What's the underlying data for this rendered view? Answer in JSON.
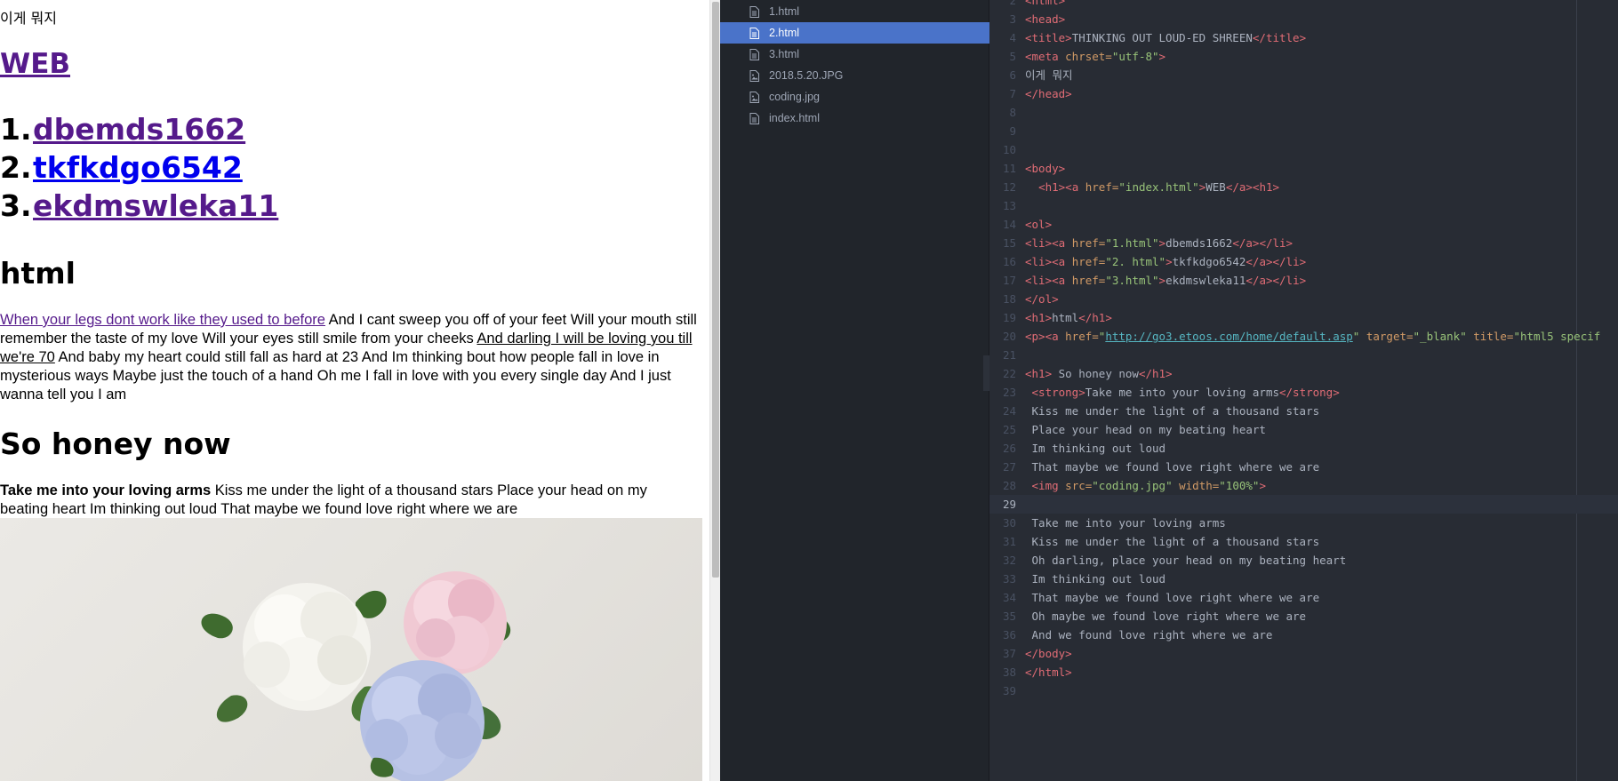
{
  "preview": {
    "meta_text": "이게 뭐지",
    "web_link": "WEB",
    "list": [
      {
        "num": "1.",
        "label": "dbemds1662"
      },
      {
        "num": "2.",
        "label": "tkfkdgo6542"
      },
      {
        "num": "3.",
        "label": "ekdmswleka11"
      }
    ],
    "html_heading": "html",
    "paragraph_link1": "When your legs dont work like they used to before",
    "paragraph_text1": " And I cant sweep you off of your feet Will your mouth still remember the taste of my love Will your eyes still smile from your cheeks ",
    "paragraph_link2": "And darling I will be loving you till we're 70",
    "paragraph_text2": " And baby my heart could still fall as hard at 23 And Im thinking bout how people fall in love in mysterious ways Maybe just the touch of a hand Oh me I fall in love with you every single day And I just wanna tell you I am",
    "honey_heading": "So honey now",
    "honey_strong": "Take me into your loving arms",
    "honey_text": " Kiss me under the light of a thousand stars Place your head on my beating heart Im thinking out loud That maybe we found love right where we are",
    "image_alt": "coding.jpg"
  },
  "tree": {
    "files": [
      {
        "name": "1.html",
        "icon": "file-icon"
      },
      {
        "name": "2.html",
        "icon": "file-icon",
        "active": true
      },
      {
        "name": "3.html",
        "icon": "file-icon"
      },
      {
        "name": "2018.5.20.JPG",
        "icon": "image-file-icon"
      },
      {
        "name": "coding.jpg",
        "icon": "image-file-icon"
      },
      {
        "name": "index.html",
        "icon": "file-icon"
      }
    ],
    "collapse_glyph": "‹"
  },
  "code": {
    "current_line": 29,
    "lines": [
      {
        "n": "2",
        "t": [
          [
            "tag",
            "<html>"
          ]
        ]
      },
      {
        "n": "3",
        "t": [
          [
            "tag",
            "<head>"
          ]
        ]
      },
      {
        "n": "4",
        "t": [
          [
            "tag",
            "<title>"
          ],
          [
            "txt",
            "THINKING OUT LOUD-ED SHREEN"
          ],
          [
            "tag",
            "</title>"
          ]
        ]
      },
      {
        "n": "5",
        "t": [
          [
            "tag",
            "<meta "
          ],
          [
            "attr",
            "chrset="
          ],
          [
            "str",
            "\"utf-8\""
          ],
          [
            "tag",
            ">"
          ]
        ]
      },
      {
        "n": "6",
        "t": [
          [
            "txt",
            "이게 뭐지"
          ]
        ]
      },
      {
        "n": "7",
        "t": [
          [
            "tag",
            "</head>"
          ]
        ]
      },
      {
        "n": "8",
        "t": []
      },
      {
        "n": "9",
        "t": []
      },
      {
        "n": "10",
        "t": []
      },
      {
        "n": "11",
        "t": [
          [
            "tag",
            "<body>"
          ]
        ]
      },
      {
        "n": "12",
        "t": [
          [
            "txt",
            "  "
          ],
          [
            "tag",
            "<h1><a "
          ],
          [
            "attr",
            "href="
          ],
          [
            "str",
            "\"index.html\""
          ],
          [
            "tag",
            ">"
          ],
          [
            "txt",
            "WEB"
          ],
          [
            "tag",
            "</a><h1>"
          ]
        ]
      },
      {
        "n": "13",
        "t": []
      },
      {
        "n": "14",
        "t": [
          [
            "tag",
            "<ol>"
          ]
        ]
      },
      {
        "n": "15",
        "t": [
          [
            "tag",
            "<li><a "
          ],
          [
            "attr",
            "href="
          ],
          [
            "str",
            "\"1.html\""
          ],
          [
            "tag",
            ">"
          ],
          [
            "txt",
            "dbemds1662"
          ],
          [
            "tag",
            "</a></li>"
          ]
        ]
      },
      {
        "n": "16",
        "t": [
          [
            "tag",
            "<li><a "
          ],
          [
            "attr",
            "href="
          ],
          [
            "str",
            "\"2. html\""
          ],
          [
            "tag",
            ">"
          ],
          [
            "txt",
            "tkfkdgo6542"
          ],
          [
            "tag",
            "</a></li>"
          ]
        ]
      },
      {
        "n": "17",
        "t": [
          [
            "tag",
            "<li><a "
          ],
          [
            "attr",
            "href="
          ],
          [
            "str",
            "\"3.html\""
          ],
          [
            "tag",
            ">"
          ],
          [
            "txt",
            "ekdmswleka11"
          ],
          [
            "tag",
            "</a></li>"
          ]
        ]
      },
      {
        "n": "18",
        "t": [
          [
            "tag",
            "</ol>"
          ]
        ]
      },
      {
        "n": "19",
        "t": [
          [
            "tag",
            "<h1>"
          ],
          [
            "txt",
            "html"
          ],
          [
            "tag",
            "</h1>"
          ]
        ]
      },
      {
        "n": "20",
        "t": [
          [
            "tag",
            "<p><a "
          ],
          [
            "attr",
            "href="
          ],
          [
            "str",
            "\""
          ],
          [
            "url",
            "http://go3.etoos.com/home/default.asp"
          ],
          [
            "str",
            "\""
          ],
          [
            "attr",
            " target="
          ],
          [
            "str",
            "\"_blank\""
          ],
          [
            "attr",
            " title="
          ],
          [
            "str",
            "\"html5 specif"
          ]
        ]
      },
      {
        "n": "21",
        "t": []
      },
      {
        "n": "22",
        "t": [
          [
            "tag",
            "<h1>"
          ],
          [
            "txt",
            " So honey now"
          ],
          [
            "tag",
            "</h1>"
          ]
        ]
      },
      {
        "n": "23",
        "t": [
          [
            "txt",
            " "
          ],
          [
            "tag",
            "<strong>"
          ],
          [
            "txt",
            "Take me into your loving arms"
          ],
          [
            "tag",
            "</strong>"
          ]
        ]
      },
      {
        "n": "24",
        "t": [
          [
            "txt",
            " Kiss me under the light of a thousand stars"
          ]
        ]
      },
      {
        "n": "25",
        "t": [
          [
            "txt",
            " Place your head on my beating heart"
          ]
        ]
      },
      {
        "n": "26",
        "t": [
          [
            "txt",
            " Im thinking out loud"
          ]
        ]
      },
      {
        "n": "27",
        "t": [
          [
            "txt",
            " That maybe we found love right where we are"
          ]
        ]
      },
      {
        "n": "28",
        "t": [
          [
            "txt",
            " "
          ],
          [
            "tag",
            "<img "
          ],
          [
            "attr",
            "src="
          ],
          [
            "str",
            "\"coding.jpg\""
          ],
          [
            "attr",
            " width="
          ],
          [
            "str",
            "\"100%\""
          ],
          [
            "tag",
            ">"
          ]
        ]
      },
      {
        "n": "29",
        "t": []
      },
      {
        "n": "30",
        "t": [
          [
            "txt",
            " Take me into your loving arms"
          ]
        ]
      },
      {
        "n": "31",
        "t": [
          [
            "txt",
            " Kiss me under the light of a thousand stars"
          ]
        ]
      },
      {
        "n": "32",
        "t": [
          [
            "txt",
            " Oh darling, place your head on my beating heart"
          ]
        ]
      },
      {
        "n": "33",
        "t": [
          [
            "txt",
            " Im thinking out loud"
          ]
        ]
      },
      {
        "n": "34",
        "t": [
          [
            "txt",
            " That maybe we found love right where we are"
          ]
        ]
      },
      {
        "n": "35",
        "t": [
          [
            "txt",
            " Oh maybe we found love right where we are"
          ]
        ]
      },
      {
        "n": "36",
        "t": [
          [
            "txt",
            " And we found love right where we are"
          ]
        ]
      },
      {
        "n": "37",
        "t": [
          [
            "tag",
            "</body>"
          ]
        ]
      },
      {
        "n": "38",
        "t": [
          [
            "tag",
            "</html>"
          ]
        ]
      },
      {
        "n": "39",
        "t": []
      }
    ]
  },
  "colors": {
    "visited_link": "#551a8b",
    "unvisited_link": "#0000ee",
    "tree_active": "#4a73c9",
    "editor_bg": "#282c34"
  }
}
